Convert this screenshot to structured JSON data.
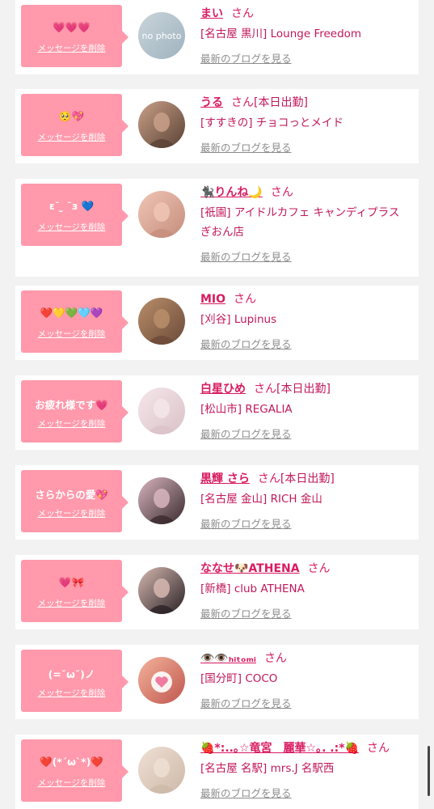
{
  "cards": [
    {
      "message": "💗💗💗",
      "delete_label": "メッセージを削除",
      "name": "まい",
      "san": "さん",
      "status": "",
      "shop": "[名古屋 黒川] Lounge Freedom",
      "blog_label": "最新のブログを見る",
      "avatar": "no-photo",
      "avatar_text": "no photo"
    },
    {
      "message": "🥺💖",
      "delete_label": "メッセージを削除",
      "name": "うる",
      "san": "さん",
      "status": "[本日出勤]",
      "shop": "[すすきの] チョコっとメイド",
      "blog_label": "最新のブログを見る",
      "avatar": "photo"
    },
    {
      "message": "ε˘ ̫ ˘з 💙",
      "delete_label": "メッセージを削除",
      "name": "🐈‍⬛りんね🌙",
      "san": "さん",
      "status": "",
      "shop": "[祇園] アイドルカフェ キャンディプラス ぎおん店",
      "blog_label": "最新のブログを見る",
      "avatar": "photo"
    },
    {
      "message": "❤️💛💚🩵💜",
      "delete_label": "メッセージを削除",
      "name": "MIO",
      "san": "さん",
      "status": "",
      "shop": "[刈谷] Lupinus",
      "blog_label": "最新のブログを見る",
      "avatar": "photo"
    },
    {
      "message": "お疲れ様です💗",
      "delete_label": "メッセージを削除",
      "name": "白星ひめ",
      "san": "さん",
      "status": "[本日出勤]",
      "shop": "[松山市] REGALIA",
      "blog_label": "最新のブログを見る",
      "avatar": "photo"
    },
    {
      "message": "さらからの愛💖",
      "delete_label": "メッセージを削除",
      "name": "黒輝 さら",
      "san": "さん",
      "status": "[本日出勤]",
      "shop": "[名古屋 金山] RICH 金山",
      "blog_label": "最新のブログを見る",
      "avatar": "photo"
    },
    {
      "message": "💗🎀",
      "delete_label": "メッセージを削除",
      "name": "ななせ🐶ATHENA",
      "san": "さん",
      "status": "",
      "shop": "[新橋] club ATHENA",
      "blog_label": "最新のブログを見る",
      "avatar": "photo"
    },
    {
      "message": "(=˘ω˘)ノ",
      "delete_label": "メッセージを削除",
      "name": "👁️👁️ₕᵢₜₒₘᵢ",
      "san": "さん",
      "status": "",
      "shop": "[国分町] COCO",
      "blog_label": "最新のブログを見る",
      "avatar": "photo"
    },
    {
      "message": "❤️(*´ω`*)❤️",
      "delete_label": "メッセージを削除",
      "name": "🍓*:..｡☆竜宮　麗華☆｡. .:*🍓",
      "san": "さん",
      "status": "",
      "shop": "[名古屋 名駅] mrs.J 名駅西",
      "blog_label": "最新のブログを見る",
      "avatar": "photo"
    }
  ],
  "colors": {
    "bubble": "#ff99ab",
    "name": "#d81b60",
    "shop": "#c2185b",
    "link": "#8c8c8c",
    "background": "#f2f2f2"
  }
}
